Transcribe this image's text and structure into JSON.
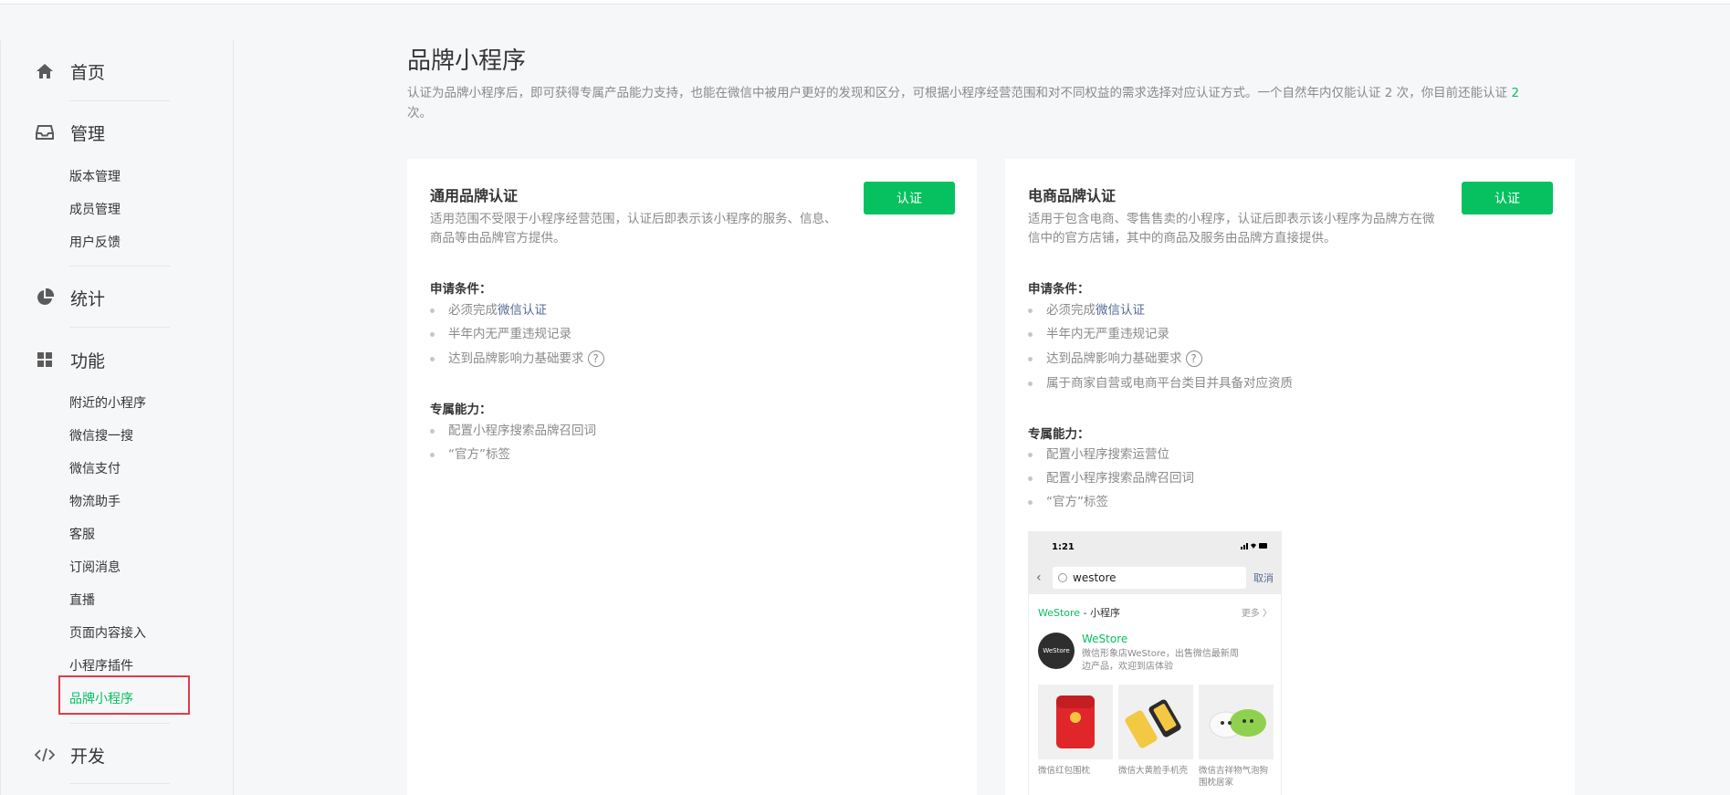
{
  "sidebar": {
    "nav": [
      {
        "label": "首页",
        "icon": "home-icon"
      },
      {
        "label": "管理",
        "icon": "inbox-icon"
      },
      {
        "label": "统计",
        "icon": "pie-chart-icon"
      },
      {
        "label": "功能",
        "icon": "grid-icon"
      },
      {
        "label": "开发",
        "icon": "code-icon"
      }
    ],
    "manage_items": [
      "版本管理",
      "成员管理",
      "用户反馈"
    ],
    "feature_items": [
      "附近的小程序",
      "微信搜一搜",
      "微信支付",
      "物流助手",
      "客服",
      "订阅消息",
      "直播",
      "页面内容接入",
      "小程序插件",
      "品牌小程序"
    ]
  },
  "main": {
    "title": "品牌小程序",
    "desc_main": "认证为品牌小程序后，即可获得专属产品能力支持，也能在微信中被用户更好的发现和区分，可根据小程序经营范围和对不同权益的需求选择对应认证方式。一个自然年内仅能认证 2 次，你目前还能认证 ",
    "desc_count": "2",
    "desc_tail": "次。"
  },
  "card_general": {
    "title": "通用品牌认证",
    "desc": "适用范围不受限于小程序经营范围，认证后即表示该小程序的服务、信息、商品等由品牌官方提供。",
    "button": "认证",
    "conditions_title": "申请条件：",
    "cond1_prefix": "必须完成",
    "cond1_link": "微信认证",
    "cond2": "半年内无严重违规记录",
    "cond3": "达到品牌影响力基础要求",
    "abilities_title": "专属能力：",
    "abilities": [
      "配置小程序搜索品牌召回词",
      "“官方”标签"
    ]
  },
  "card_ecommerce": {
    "title": "电商品牌认证",
    "desc": "适用于包含电商、零售售卖的小程序，认证后即表示该小程序为品牌方在微信中的官方店铺，其中的商品及服务由品牌方直接提供。",
    "button": "认证",
    "conditions_title": "申请条件：",
    "cond1_prefix": "必须完成",
    "cond1_link": "微信认证",
    "cond2": "半年内无严重违规记录",
    "cond3": "达到品牌影响力基础要求",
    "cond4": "属于商家自营或电商平台类目并具备对应资质",
    "abilities_title": "专属能力：",
    "abilities": [
      "配置小程序搜索运营位",
      "配置小程序搜索品牌召回词",
      "“官方”标签"
    ]
  },
  "phone": {
    "time": "1:21",
    "search_text": "westore",
    "cancel": "取消",
    "result_brand": "WeStore",
    "result_suffix": " - 小程序",
    "more": "更多 〉",
    "app_name": "WeStore",
    "app_desc": "微信形象店WeStore，出售微信最新周边产品，欢迎到店体验",
    "logo_text": "WeStore",
    "products": [
      "微信红包围枕",
      "微信大黄脸手机壳",
      "微信吉祥物气泡狗围枕居家"
    ]
  },
  "colors": {
    "accent": "#07c160",
    "link": "#576b95",
    "highlight_border": "#e03c48"
  }
}
